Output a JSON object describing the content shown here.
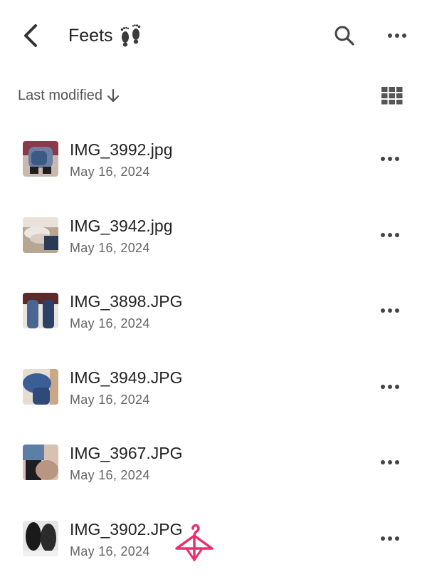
{
  "header": {
    "title": "Feets",
    "title_emoji_icon": "footprints-icon"
  },
  "sort": {
    "label": "Last modified",
    "direction_icon": "arrow-down-icon"
  },
  "files": [
    {
      "name": "IMG_3992.jpg",
      "date": "May 16, 2024",
      "thumb_colors": [
        "#6b7fa3",
        "#3c5a87",
        "#c9b8b0",
        "#1e1e1e"
      ]
    },
    {
      "name": "IMG_3942.jpg",
      "date": "May 16, 2024",
      "thumb_colors": [
        "#d9ccc2",
        "#ece6e2",
        "#2c3a55",
        "#b8a592"
      ]
    },
    {
      "name": "IMG_3898.JPG",
      "date": "May 16, 2024",
      "thumb_colors": [
        "#5b2a2a",
        "#4a6591",
        "#2d4066",
        "#e8e4df"
      ]
    },
    {
      "name": "IMG_3949.JPG",
      "date": "May 16, 2024",
      "thumb_colors": [
        "#3b5f94",
        "#2d4a78",
        "#c7a987",
        "#e6ddd1"
      ]
    },
    {
      "name": "IMG_3967.JPG",
      "date": "May 16, 2024",
      "thumb_colors": [
        "#5c7fa8",
        "#1e1e22",
        "#b99682",
        "#d8c1b2"
      ]
    },
    {
      "name": "IMG_3902.JPG",
      "date": "May 16, 2024",
      "thumb_colors": [
        "#1a1a1a",
        "#e6e6e6",
        "#2b2b2b",
        "#f0f0f0"
      ]
    }
  ],
  "icons": {
    "back": "chevron-left-icon",
    "search": "search-icon",
    "more": "more-horizontal-icon",
    "grid": "grid-view-icon",
    "overlay": "hanger-icon"
  },
  "colors": {
    "text": "#222222",
    "secondary": "#666666",
    "icon": "#444444",
    "overlay": "#e8306f"
  }
}
